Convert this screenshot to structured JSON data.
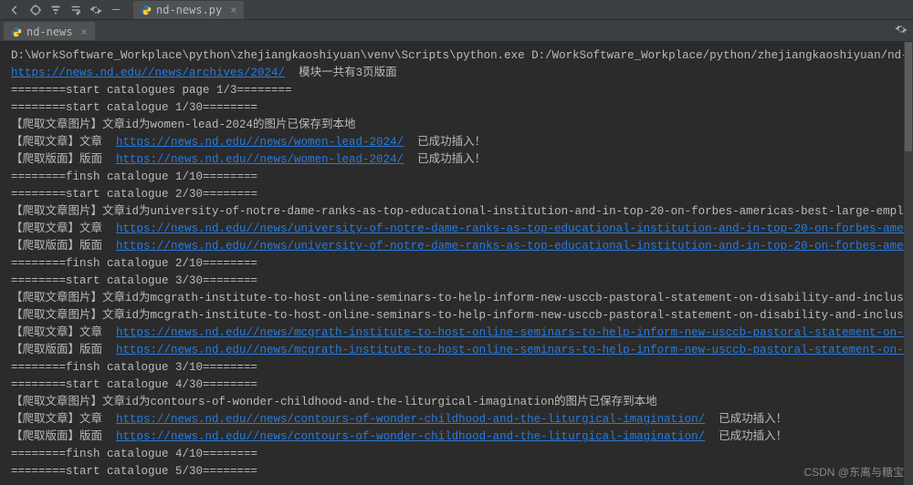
{
  "toolbar": {
    "icons": [
      "back-icon",
      "cycle-icon",
      "filter-icon",
      "wrap-icon",
      "gear-icon",
      "minimize-icon"
    ]
  },
  "editor_tab": {
    "label": "nd-news.py"
  },
  "run_tab": {
    "label": "nd-news"
  },
  "watermark": "CSDN @东离与糖宝",
  "console": {
    "cmd_line": "D:\\WorkSoftware_Workplace\\python\\zhejiangkaoshiyuan\\venv\\Scripts\\python.exe D:/WorkSoftware_Workplace/python/zhejiangkaoshiyuan/nd-news/nd-news",
    "archives_url": "https://news.nd.edu//news/archives/2024/",
    "archives_suffix": "  模块一共有3页版面",
    "sep_start_pages": "========start catalogues page 1/3========",
    "items": [
      {
        "start": "========start catalogue 1/30========",
        "img_lines": [
          "【爬取文章图片】文章id为women-lead-2024的图片已保存到本地"
        ],
        "article_prefix": "【爬取文章】文章  ",
        "article_url": "https://news.nd.edu//news/women-lead-2024/",
        "inserted": "  已成功插入！",
        "page_prefix": "【爬取版面】版面  ",
        "page_url": "https://news.nd.edu//news/women-lead-2024/",
        "finish": "========finsh catalogue 1/10========"
      },
      {
        "start": "========start catalogue 2/30========",
        "img_lines": [
          "【爬取文章图片】文章id为university-of-notre-dame-ranks-as-top-educational-institution-and-in-top-20-on-forbes-americas-best-large-employers-list的图片"
        ],
        "article_prefix": "【爬取文章】文章  ",
        "article_url": "https://news.nd.edu//news/university-of-notre-dame-ranks-as-top-educational-institution-and-in-top-20-on-forbes-americas-best-larg",
        "inserted": "",
        "page_prefix": "【爬取版面】版面  ",
        "page_url": "https://news.nd.edu//news/university-of-notre-dame-ranks-as-top-educational-institution-and-in-top-20-on-forbes-americas-best-larg",
        "finish": "========finsh catalogue 2/10========"
      },
      {
        "start": "========start catalogue 3/30========",
        "img_lines": [
          "【爬取文章图片】文章id为mcgrath-institute-to-host-online-seminars-to-help-inform-new-usccb-pastoral-statement-on-disability-and-inclusion-in-the-chu",
          "【爬取文章图片】文章id为mcgrath-institute-to-host-online-seminars-to-help-inform-new-usccb-pastoral-statement-on-disability-and-inclusion-in-the-chu"
        ],
        "article_prefix": "【爬取文章】文章  ",
        "article_url": "https://news.nd.edu//news/mcgrath-institute-to-host-online-seminars-to-help-inform-new-usccb-pastoral-statement-on-disability-and-",
        "inserted": "",
        "page_prefix": "【爬取版面】版面  ",
        "page_url": "https://news.nd.edu//news/mcgrath-institute-to-host-online-seminars-to-help-inform-new-usccb-pastoral-statement-on-disability-and-",
        "finish": "========finsh catalogue 3/10========"
      },
      {
        "start": "========start catalogue 4/30========",
        "img_lines": [
          "",
          "【爬取文章图片】文章id为contours-of-wonder-childhood-and-the-liturgical-imagination的图片已保存到本地"
        ],
        "article_prefix": "【爬取文章】文章  ",
        "article_url": "https://news.nd.edu//news/contours-of-wonder-childhood-and-the-liturgical-imagination/",
        "inserted": "  已成功插入！",
        "page_prefix": "【爬取版面】版面  ",
        "page_url": "https://news.nd.edu//news/contours-of-wonder-childhood-and-the-liturgical-imagination/",
        "finish": "========finsh catalogue 4/10========"
      }
    ],
    "trailing": "========start catalogue 5/30========"
  }
}
